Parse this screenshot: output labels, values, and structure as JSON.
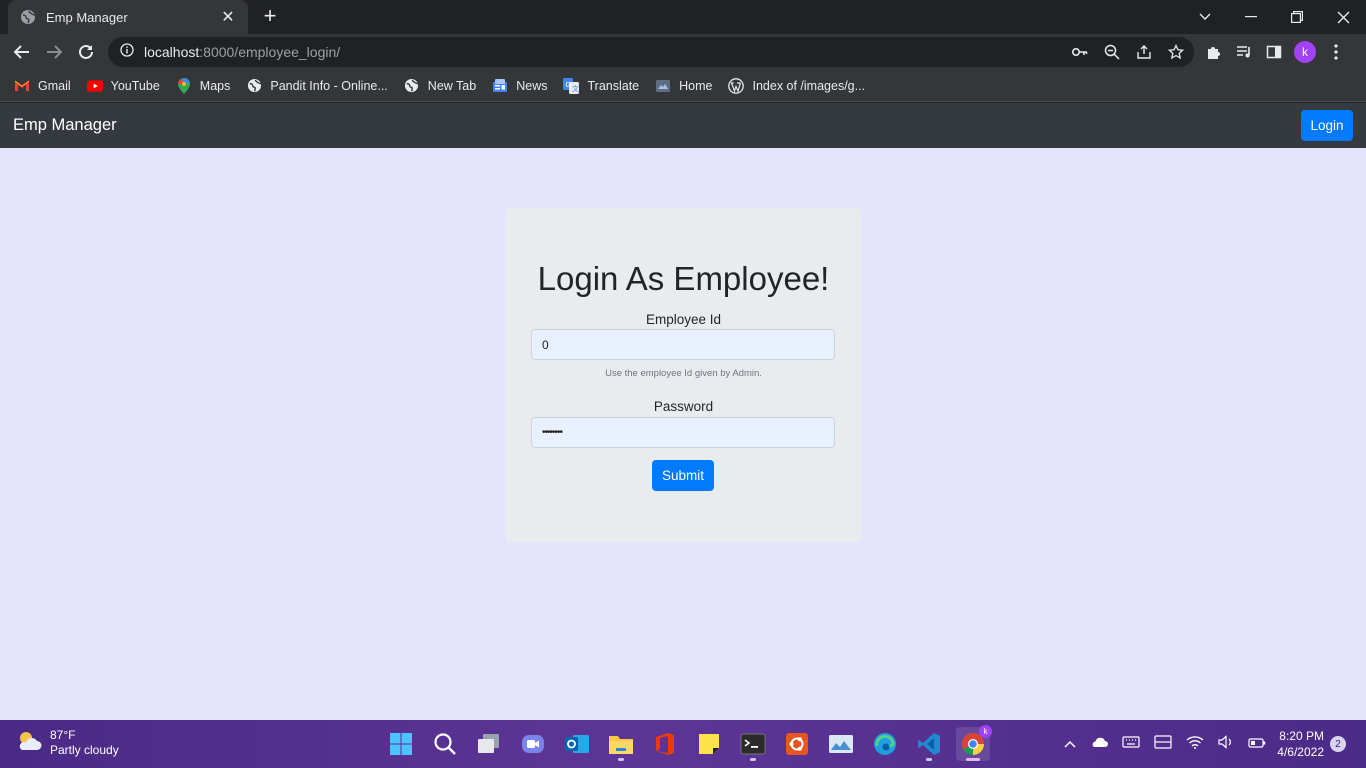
{
  "browser": {
    "tab_title": "Emp Manager",
    "url_host": "localhost",
    "url_path": ":8000/employee_login/",
    "bookmarks": [
      {
        "label": "Gmail",
        "icon": "gmail-icon"
      },
      {
        "label": "YouTube",
        "icon": "youtube-icon"
      },
      {
        "label": "Maps",
        "icon": "maps-icon"
      },
      {
        "label": "Pandit Info - Online...",
        "icon": "globe-icon"
      },
      {
        "label": "New Tab",
        "icon": "globe-icon"
      },
      {
        "label": "News",
        "icon": "news-icon"
      },
      {
        "label": "Translate",
        "icon": "translate-icon"
      },
      {
        "label": "Home",
        "icon": "home-icon"
      },
      {
        "label": "Index of /images/g...",
        "icon": "wordpress-icon"
      }
    ],
    "profile_initial": "k"
  },
  "navbar": {
    "brand": "Emp Manager",
    "login_button": "Login"
  },
  "login_form": {
    "title": "Login As Employee!",
    "employee_id_label": "Employee Id",
    "employee_id_value": "0",
    "employee_id_help": "Use the employee Id given by Admin.",
    "password_label": "Password",
    "password_value": "••••••••",
    "submit_label": "Submit"
  },
  "taskbar": {
    "weather_temp": "87°F",
    "weather_desc": "Partly cloudy",
    "time": "8:20 PM",
    "date": "4/6/2022",
    "notification_count": "2"
  },
  "colors": {
    "page_bg": "#e5e4fd",
    "navbar_bg": "#343a40",
    "primary": "#007bff",
    "card_bg": "#e9ecef"
  }
}
